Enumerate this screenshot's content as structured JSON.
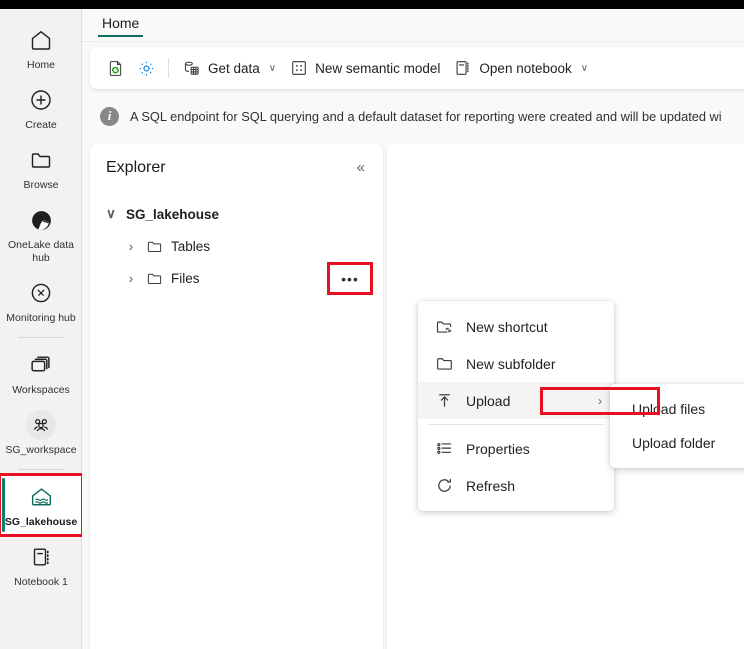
{
  "rail": {
    "items": [
      {
        "label": "Home",
        "icon": "home-icon"
      },
      {
        "label": "Create",
        "icon": "plus-circle-icon"
      },
      {
        "label": "Browse",
        "icon": "folder-icon"
      },
      {
        "label": "OneLake data hub",
        "icon": "onelake-icon"
      },
      {
        "label": "Monitoring hub",
        "icon": "monitoring-icon"
      },
      {
        "label": "Workspaces",
        "icon": "workspaces-icon"
      },
      {
        "label": "SG_workspace",
        "icon": "people-group-icon"
      },
      {
        "label": "SG_lakehouse",
        "icon": "lakehouse-icon"
      },
      {
        "label": "Notebook 1",
        "icon": "notebook-icon"
      }
    ]
  },
  "tabs": [
    {
      "label": "Home",
      "active": true
    }
  ],
  "toolbar": {
    "refresh_icon": "refresh-page-icon",
    "settings_icon": "gear-icon",
    "get_data": "Get data",
    "new_semantic_model": "New semantic model",
    "open_notebook": "Open notebook",
    "chevron": "∨"
  },
  "infobar": {
    "icon": "info-icon",
    "badge_glyph": "i",
    "text": "A SQL endpoint for SQL querying and a default dataset for reporting were created and will be updated wi"
  },
  "explorer": {
    "title": "Explorer",
    "collapse_icon": "chevron-double-left-icon",
    "collapse_glyph": "«",
    "root": {
      "label": "SG_lakehouse",
      "expanded": true,
      "chevron": "∨"
    },
    "nodes": [
      {
        "label": "Tables",
        "chevron": "›",
        "icon": "folder-icon",
        "has_more": false
      },
      {
        "label": "Files",
        "chevron": "›",
        "icon": "folder-icon",
        "has_more": true,
        "more_glyph": "•••",
        "more_highlighted": true
      }
    ]
  },
  "context_menu": {
    "items": [
      {
        "label": "New shortcut",
        "icon": "shortcut-folder-icon",
        "highlighted": false,
        "submenu": false
      },
      {
        "label": "New subfolder",
        "icon": "folder-icon",
        "highlighted": false,
        "submenu": false
      },
      {
        "label": "Upload",
        "icon": "upload-arrow-icon",
        "highlighted": true,
        "submenu": true,
        "arrow": "›"
      },
      {
        "divider": true
      },
      {
        "label": "Properties",
        "icon": "properties-list-icon",
        "highlighted": false,
        "submenu": false
      },
      {
        "label": "Refresh",
        "icon": "refresh-icon",
        "highlighted": false,
        "submenu": false
      }
    ]
  },
  "submenu": {
    "items": [
      {
        "label": "Upload files",
        "highlighted": true
      },
      {
        "label": "Upload folder",
        "highlighted": false
      }
    ]
  },
  "colors": {
    "accent_teal": "#0f6c5e",
    "highlight_red": "#e81123",
    "rail_bg": "#f3f2f1",
    "card_bg": "#ffffff",
    "page_bg": "#faf9f8"
  }
}
